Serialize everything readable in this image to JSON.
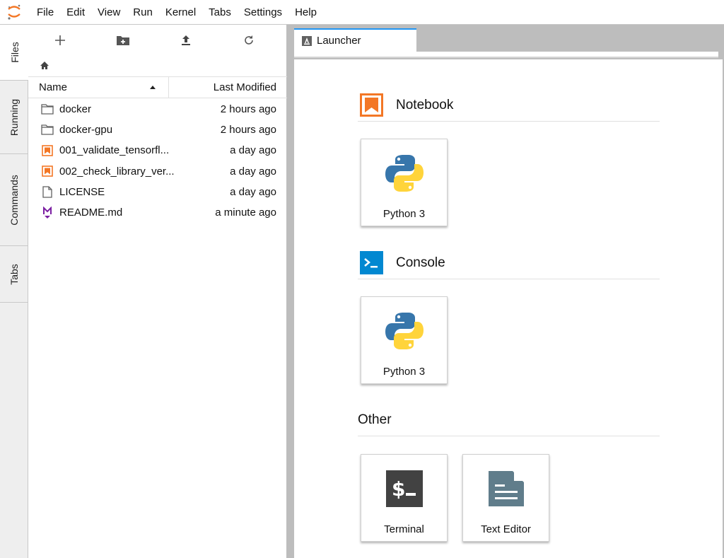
{
  "menubar": {
    "logo_icon": "jupyter-logo-icon",
    "items": [
      "File",
      "Edit",
      "View",
      "Run",
      "Kernel",
      "Tabs",
      "Settings",
      "Help"
    ]
  },
  "left_sidebar": {
    "tabs": [
      {
        "label": "Files",
        "active": true
      },
      {
        "label": "Running",
        "active": false
      },
      {
        "label": "Commands",
        "active": false
      },
      {
        "label": "Tabs",
        "active": false
      }
    ]
  },
  "file_browser": {
    "toolbar": [
      {
        "name": "new-launcher",
        "icon": "plus-icon"
      },
      {
        "name": "new-folder",
        "icon": "new-folder-icon"
      },
      {
        "name": "upload",
        "icon": "upload-icon"
      },
      {
        "name": "refresh",
        "icon": "refresh-icon"
      }
    ],
    "breadcrumb_icon": "home-icon",
    "columns": {
      "name": "Name",
      "modified": "Last Modified",
      "sort": "ascending"
    },
    "files": [
      {
        "name": "docker",
        "type": "folder",
        "modified": "2 hours ago"
      },
      {
        "name": "docker-gpu",
        "type": "folder",
        "modified": "2 hours ago"
      },
      {
        "name": "001_validate_tensorfl...",
        "type": "notebook",
        "modified": "a day ago"
      },
      {
        "name": "002_check_library_ver...",
        "type": "notebook",
        "modified": "a day ago"
      },
      {
        "name": "LICENSE",
        "type": "file",
        "modified": "a day ago"
      },
      {
        "name": "README.md",
        "type": "markdown",
        "modified": "a minute ago"
      }
    ]
  },
  "main": {
    "tabs": [
      {
        "label": "Launcher",
        "icon": "launcher-icon",
        "active": true
      }
    ],
    "launcher": {
      "sections": [
        {
          "title": "Notebook",
          "icon": "notebook-icon",
          "cards": [
            {
              "label": "Python 3",
              "icon": "python-logo-icon"
            }
          ]
        },
        {
          "title": "Console",
          "icon": "console-icon",
          "cards": [
            {
              "label": "Python 3",
              "icon": "python-logo-icon"
            }
          ]
        },
        {
          "title": "Other",
          "icon": "",
          "cards": [
            {
              "label": "Terminal",
              "icon": "terminal-icon"
            },
            {
              "label": "Text Editor",
              "icon": "text-editor-icon"
            }
          ]
        }
      ]
    }
  },
  "colors": {
    "accent": "#2196f3",
    "notebook_orange": "#f37726",
    "console_blue": "#0288d1",
    "markdown_purple": "#7b1fa2",
    "terminal_bg": "#424242",
    "text_editor": "#607d8b"
  }
}
